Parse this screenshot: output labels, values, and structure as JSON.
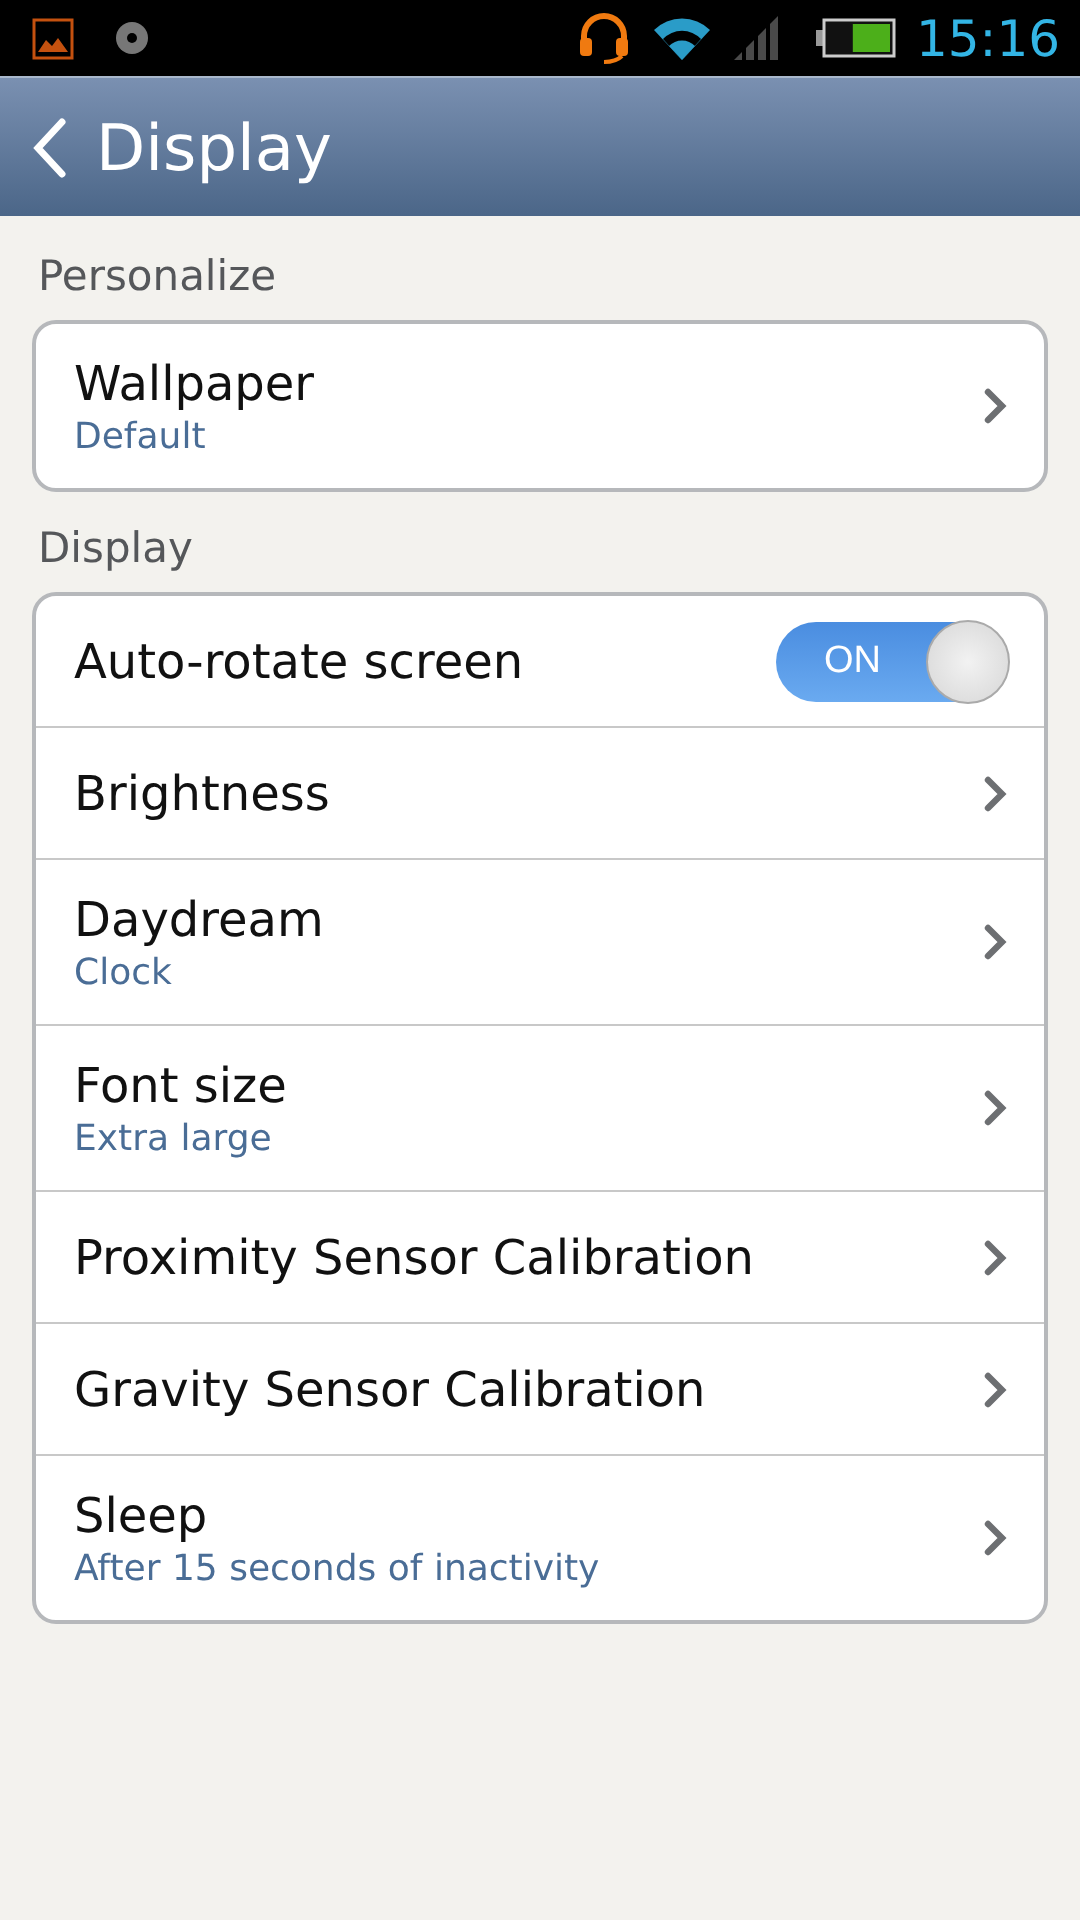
{
  "status_bar": {
    "time": "15:16"
  },
  "header": {
    "title": "Display"
  },
  "sections": [
    {
      "title": "Personalize",
      "items": [
        {
          "kind": "link",
          "label": "Wallpaper",
          "summary": "Default"
        }
      ]
    },
    {
      "title": "Display",
      "items": [
        {
          "kind": "toggle",
          "label": "Auto-rotate screen",
          "on": true,
          "toggle_text": "ON"
        },
        {
          "kind": "link",
          "label": "Brightness"
        },
        {
          "kind": "link",
          "label": "Daydream",
          "summary": "Clock"
        },
        {
          "kind": "link",
          "label": "Font size",
          "summary": "Extra large"
        },
        {
          "kind": "link",
          "label": "Proximity Sensor Calibration"
        },
        {
          "kind": "link",
          "label": "Gravity Sensor Calibration"
        },
        {
          "kind": "link",
          "label": "Sleep",
          "summary": "After 15 seconds of inactivity"
        }
      ]
    }
  ]
}
